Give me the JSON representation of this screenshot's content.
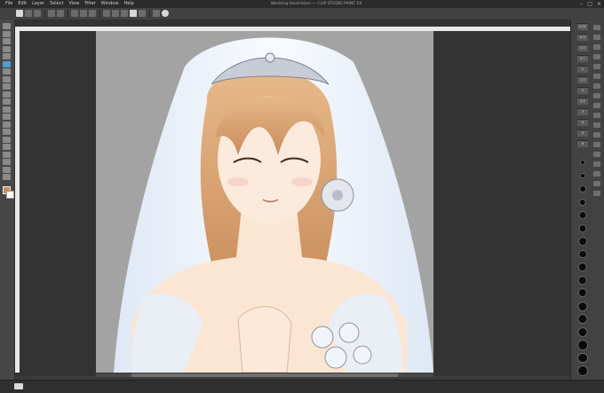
{
  "app": {
    "title": "Clip Studio Paint",
    "doc_title": "Wedding illustration — CLIP STUDIO PAINT EX"
  },
  "menu": {
    "items": [
      "File",
      "Edit",
      "Layer",
      "Select",
      "View",
      "Filter",
      "Window",
      "Help"
    ]
  },
  "toolbar": {
    "tools": [
      {
        "name": "zoom-tool",
        "active": false
      },
      {
        "name": "move-tool",
        "active": false
      },
      {
        "name": "operation-tool",
        "active": false
      },
      {
        "name": "selection-tool",
        "active": false
      },
      {
        "name": "auto-select-tool",
        "active": false
      },
      {
        "name": "eyedropper-tool",
        "active": true
      },
      {
        "name": "pen-tool",
        "active": false
      },
      {
        "name": "pencil-tool",
        "active": false
      },
      {
        "name": "brush-tool",
        "active": false
      },
      {
        "name": "airbrush-tool",
        "active": false
      },
      {
        "name": "decoration-tool",
        "active": false
      },
      {
        "name": "eraser-tool",
        "active": false
      },
      {
        "name": "blend-tool",
        "active": false
      },
      {
        "name": "fill-tool",
        "active": false
      },
      {
        "name": "gradient-tool",
        "active": false
      },
      {
        "name": "figure-tool",
        "active": false
      },
      {
        "name": "frame-tool",
        "active": false
      },
      {
        "name": "ruler-tool",
        "active": false
      },
      {
        "name": "text-tool",
        "active": false
      },
      {
        "name": "balloon-tool",
        "active": false
      },
      {
        "name": "correct-line-tool",
        "active": false
      }
    ],
    "main_color": "#c98c5b",
    "sub_color": "#ffffff"
  },
  "zoom_levels": [
    "0.01",
    "0.3",
    "0.5",
    "0.7",
    "1",
    "1.5",
    "2",
    "2.5",
    "3",
    "4",
    "5",
    "6"
  ],
  "brush_sizes": [
    6,
    7,
    8,
    9,
    10,
    10,
    11,
    11,
    12,
    12,
    12,
    13,
    13,
    13,
    14,
    14,
    14
  ],
  "colors": {
    "canvas_bg": "#a3a3a3",
    "skin": "#fbe6d4",
    "hair": "#d9a06a",
    "veil": "#eef3fb",
    "accent": "#4aa3c9"
  }
}
